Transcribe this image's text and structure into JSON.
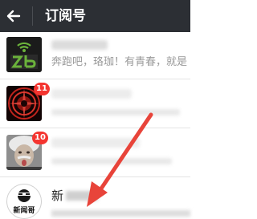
{
  "header": {
    "back_icon": "arrow-left-icon",
    "title": "订阅号"
  },
  "rows": [
    {
      "avatar_icon": "zb-logo-icon",
      "preview": "奔跑吧，珞珈！有青春，就是"
    },
    {
      "avatar_icon": "red-pattern-icon",
      "badge": "11"
    },
    {
      "avatar_icon": "einstein-photo-icon",
      "badge": "10"
    },
    {
      "avatar_icon": "xinwen-logo-icon",
      "avatar_text": "新闻哥",
      "name": "新"
    }
  ],
  "colors": {
    "header_bg": "#2c2f34",
    "badge_bg": "#f43530",
    "annotation_arrow": "#e8443a",
    "zb_green": "#6bb23b"
  }
}
